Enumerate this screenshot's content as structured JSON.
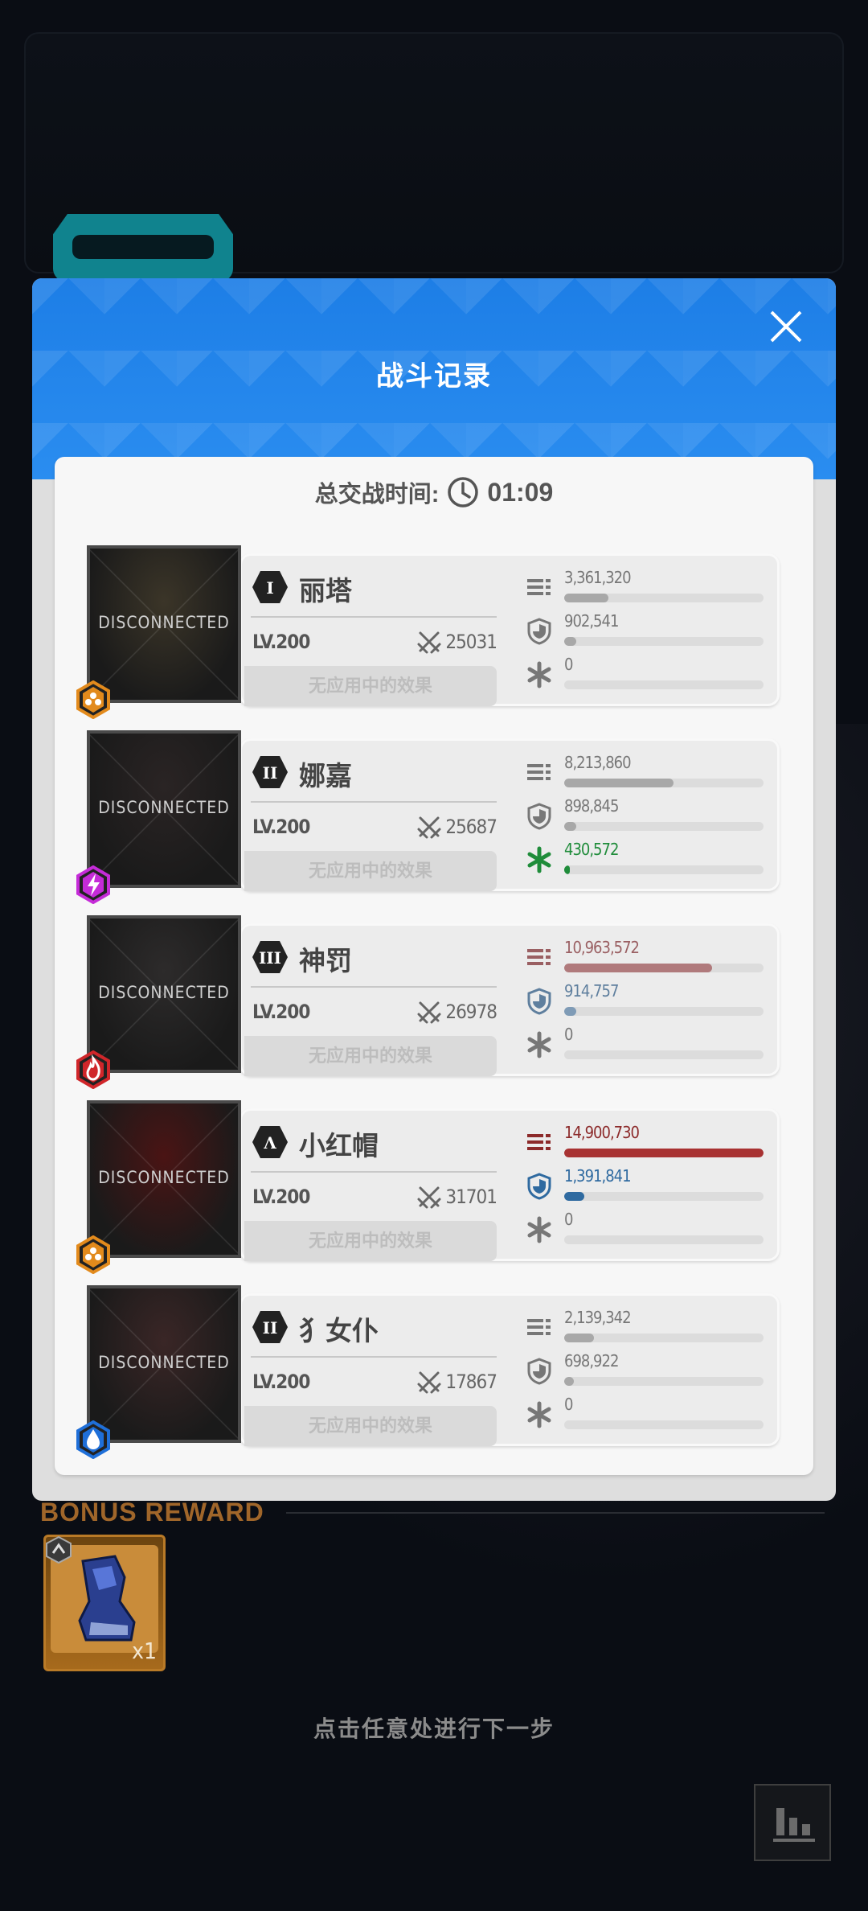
{
  "modal": {
    "title": "战斗记录",
    "total_time_label": "总交战时间:",
    "total_time": "01:09"
  },
  "characters": [
    {
      "name": "丽塔",
      "rank": "I",
      "level": "LV.200",
      "power": "25031",
      "effect": "无应用中的效果",
      "status": "DISCONNECTED",
      "element_icon": "hexagon-cells-icon",
      "element_color": "#e28a1c",
      "portrait_color": "#3b3528",
      "damage": {
        "value": "3,361,320",
        "fill": 0.22,
        "color": "#a8a8a8",
        "icon_color": "#777777",
        "value_color": "#777777"
      },
      "taken": {
        "value": "902,541",
        "fill": 0.06,
        "color": "#a8a8a8",
        "icon_color": "#777777",
        "value_color": "#777777"
      },
      "heal": {
        "value": "0",
        "fill": 0.0,
        "color": "#a8a8a8",
        "icon_color": "#777777",
        "value_color": "#777777"
      }
    },
    {
      "name": "娜嘉",
      "rank": "II",
      "level": "LV.200",
      "power": "25687",
      "effect": "无应用中的效果",
      "status": "DISCONNECTED",
      "element_icon": "lightning-icon",
      "element_color": "#c52bd8",
      "portrait_color": "#2a2424",
      "damage": {
        "value": "8,213,860",
        "fill": 0.55,
        "color": "#a8a8a8",
        "icon_color": "#777777",
        "value_color": "#777777"
      },
      "taken": {
        "value": "898,845",
        "fill": 0.06,
        "color": "#a8a8a8",
        "icon_color": "#777777",
        "value_color": "#777777"
      },
      "heal": {
        "value": "430,572",
        "fill": 0.03,
        "color": "#1f8c3a",
        "icon_color": "#1f8c3a",
        "value_color": "#1f8c3a"
      }
    },
    {
      "name": "神罚",
      "rank": "III",
      "level": "LV.200",
      "power": "26978",
      "effect": "无应用中的效果",
      "status": "DISCONNECTED",
      "element_icon": "fire-icon",
      "element_color": "#d0262a",
      "portrait_color": "#2d2b2b",
      "damage": {
        "value": "10,963,572",
        "fill": 0.74,
        "color": "#b07a7c",
        "icon_color": "#9a5f62",
        "value_color": "#9a5f62"
      },
      "taken": {
        "value": "914,757",
        "fill": 0.06,
        "color": "#7f9bb6",
        "icon_color": "#5f7f9e",
        "value_color": "#5f7f9e"
      },
      "heal": {
        "value": "0",
        "fill": 0.0,
        "color": "#a8a8a8",
        "icon_color": "#777777",
        "value_color": "#777777"
      }
    },
    {
      "name": "小红帽",
      "rank": "Λ",
      "level": "LV.200",
      "power": "31701",
      "effect": "无应用中的效果",
      "status": "DISCONNECTED",
      "element_icon": "hexagon-cells-icon",
      "element_color": "#e28a1c",
      "portrait_color": "#4a1414",
      "damage": {
        "value": "14,900,730",
        "fill": 1.0,
        "color": "#a83232",
        "icon_color": "#8c2a2a",
        "value_color": "#8c2a2a"
      },
      "taken": {
        "value": "1,391,841",
        "fill": 0.1,
        "color": "#2f6aa0",
        "icon_color": "#2f6aa0",
        "value_color": "#2f6aa0"
      },
      "heal": {
        "value": "0",
        "fill": 0.0,
        "color": "#a8a8a8",
        "icon_color": "#777777",
        "value_color": "#777777"
      }
    },
    {
      "name": "犭女仆",
      "rank": "II",
      "level": "LV.200",
      "power": "17867",
      "effect": "无应用中的效果",
      "status": "DISCONNECTED",
      "element_icon": "water-drop-icon",
      "element_color": "#1f6fd8",
      "portrait_color": "#3a2626",
      "damage": {
        "value": "2,139,342",
        "fill": 0.15,
        "color": "#a8a8a8",
        "icon_color": "#777777",
        "value_color": "#777777"
      },
      "taken": {
        "value": "698,922",
        "fill": 0.05,
        "color": "#a8a8a8",
        "icon_color": "#777777",
        "value_color": "#777777"
      },
      "heal": {
        "value": "0",
        "fill": 0.0,
        "color": "#a8a8a8",
        "icon_color": "#777777",
        "value_color": "#777777"
      }
    }
  ],
  "bonus": {
    "title": "BONUS REWARD",
    "item_quantity": "x1",
    "item_icon": "mech-boot-icon"
  },
  "continue_hint": "点击任意处进行下一步",
  "stats_button_icon": "bar-chart-icon"
}
